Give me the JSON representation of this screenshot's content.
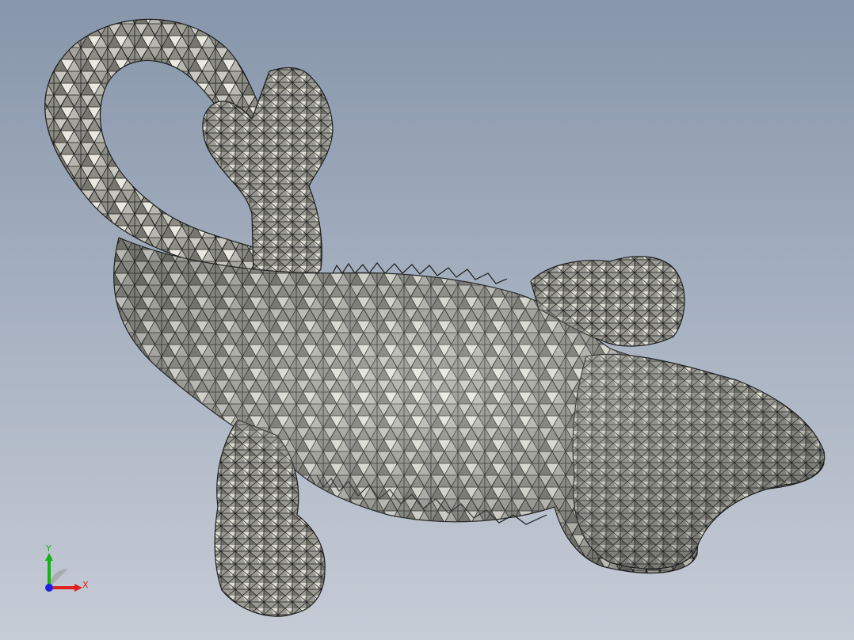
{
  "viewport": {
    "background_top": "#8796ab",
    "background_bottom": "#c6ccd6",
    "model_fill": "#8d8d86",
    "model_highlight": "#f4f4ea",
    "mesh_line_color": "#1c1c1c"
  },
  "triad": {
    "x_label": "X",
    "y_label": "Y",
    "x_color": "#e02020",
    "y_color": "#18b018",
    "z_color": "#2020e0"
  }
}
